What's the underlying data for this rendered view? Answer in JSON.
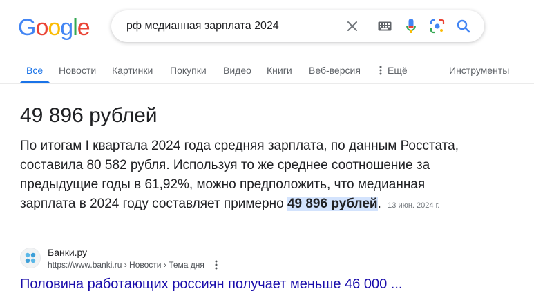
{
  "logo": {
    "letters": [
      "G",
      "o",
      "o",
      "g",
      "l",
      "e"
    ],
    "colors": [
      "#4285F4",
      "#EA4335",
      "#FBBC05",
      "#4285F4",
      "#34A853",
      "#EA4335"
    ]
  },
  "search": {
    "query": "рф медианная зарплата 2024"
  },
  "icons": {
    "clear": "close-icon",
    "keyboard": "keyboard-icon",
    "voice": "microphone-icon",
    "lens": "camera-lens-icon",
    "search": "search-icon",
    "more_vertical": "more-vert-icon"
  },
  "tabs": [
    {
      "label": "Все",
      "active": true
    },
    {
      "label": "Новости"
    },
    {
      "label": "Картинки"
    },
    {
      "label": "Покупки"
    },
    {
      "label": "Видео"
    },
    {
      "label": "Книги"
    },
    {
      "label": "Веб-версия"
    },
    {
      "label": "Ещё"
    }
  ],
  "tools_label": "Инструменты",
  "answer": {
    "title": "49 896 рублей",
    "text_before": "По итогам I квартала 2024 года средняя зарплата, по данным Росстата, составила 80 582 рубля. Используя то же среднее соотношение за предыдущие годы в 61,92%, можно предположить, что медианная зарплата в 2024 году составляет примерно ",
    "highlight": "49 896 рублей",
    "text_after": ".",
    "date": "13 июн. 2024 г."
  },
  "source": {
    "name": "Банки.ру",
    "url": "https://www.banki.ru › Новости › Тема дня",
    "link_title": "Половина работающих россиян получает меньше 46 000 ..."
  },
  "colors": {
    "accent": "#1a73e8",
    "link": "#1a0dab",
    "highlight": "#d3e3fd"
  }
}
